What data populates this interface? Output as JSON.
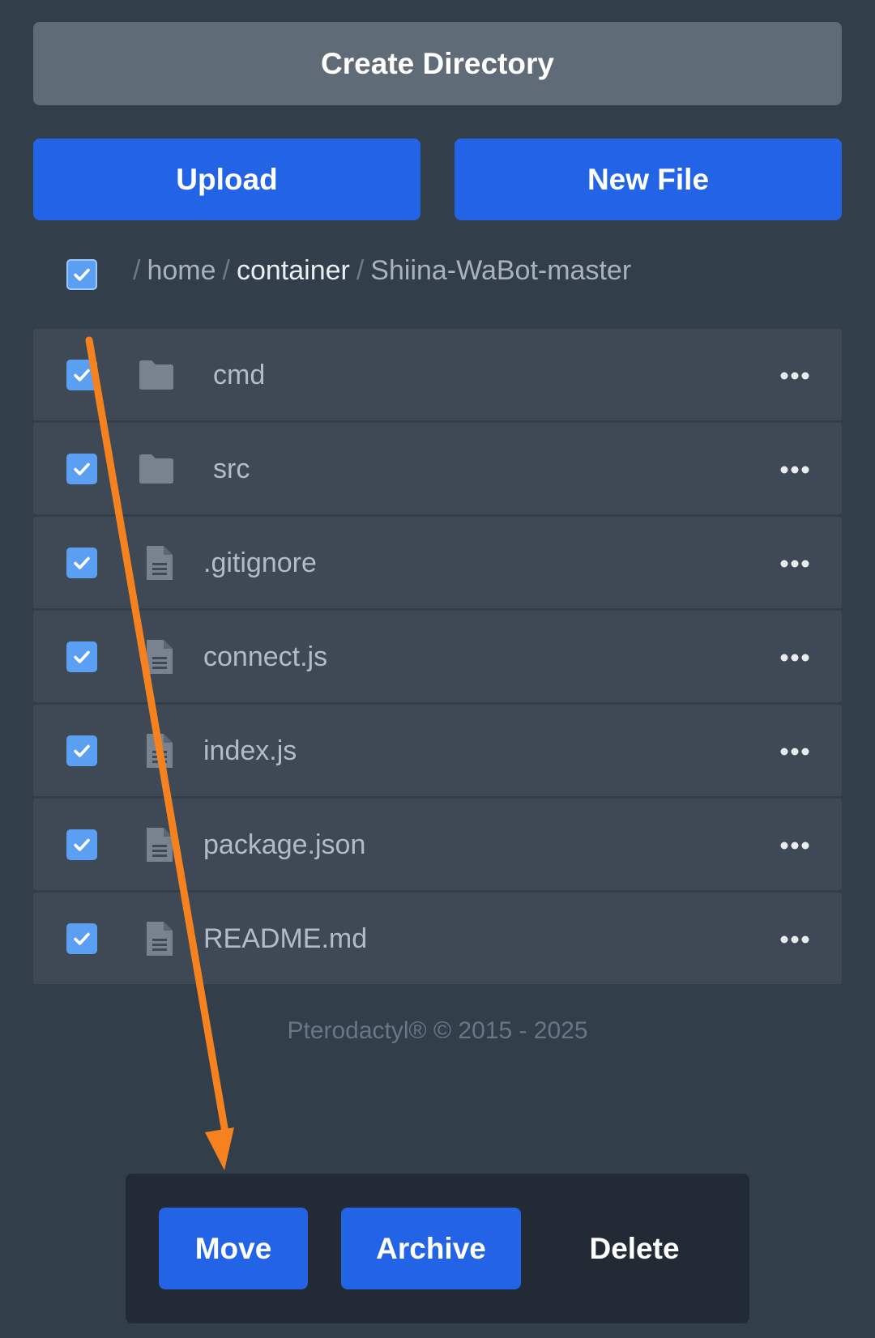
{
  "toolbar": {
    "create_directory": "Create Directory",
    "upload": "Upload",
    "new_file": "New File"
  },
  "breadcrumb": {
    "separator": "/",
    "items": [
      "home",
      "container",
      "Shiina-WaBot-master"
    ]
  },
  "files": [
    {
      "name": "cmd",
      "type": "folder",
      "icon": "folder-icon",
      "checked": true
    },
    {
      "name": "src",
      "type": "folder",
      "icon": "folder-icon",
      "checked": true
    },
    {
      "name": ".gitignore",
      "type": "file",
      "icon": "file-icon",
      "checked": true
    },
    {
      "name": "connect.js",
      "type": "file",
      "icon": "file-icon",
      "checked": true
    },
    {
      "name": "index.js",
      "type": "file",
      "icon": "file-icon",
      "checked": true
    },
    {
      "name": "package.json",
      "type": "file",
      "icon": "file-icon",
      "checked": true
    },
    {
      "name": "README.md",
      "type": "file",
      "icon": "file-icon",
      "checked": true
    }
  ],
  "footer": {
    "text": "Pterodactyl® © 2015 - 2025"
  },
  "mass_actions": {
    "move": "Move",
    "archive": "Archive",
    "delete": "Delete"
  },
  "colors": {
    "background": "#333e4b",
    "primary_button": "#2363e6",
    "secondary_button": "#5f6b77",
    "checkbox": "#5b9ff2",
    "annotation_arrow": "#f5821f"
  }
}
